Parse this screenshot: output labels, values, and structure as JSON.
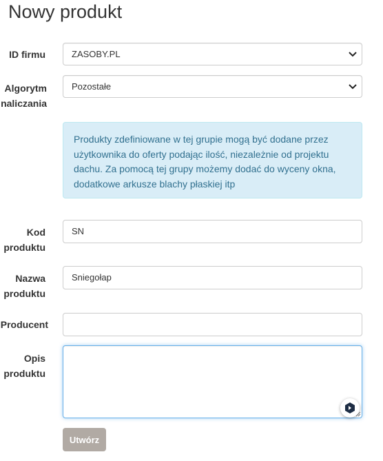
{
  "page": {
    "title": "Nowy produkt"
  },
  "form": {
    "id_firmu": {
      "label": "ID firmu",
      "value": "ZASOBY.PL"
    },
    "algorytm": {
      "label_line1": "Algorytm",
      "label_line2": "naliczania",
      "value": "Pozostałe"
    },
    "info_text": "Produkty zdefiniowane w tej grupie mogą być dodane przez użytkownika do oferty podając ilość, niezależnie od projektu dachu. Za pomocą tej grupy możemy dodać do wyceny okna, dodatkowe arkusze blachy płaskiej itp",
    "kod": {
      "label_line1": "Kod",
      "label_line2": "produktu",
      "value": "SN"
    },
    "nazwa": {
      "label_line1": "Nazwa",
      "label_line2": "produktu",
      "value": "Sniegołap"
    },
    "producent": {
      "label": "Producent",
      "value": ""
    },
    "opis": {
      "label_line1": "Opis",
      "label_line2": "produktu",
      "value": ""
    },
    "submit_label": "Utwórz"
  },
  "icons": {
    "select_arrow": "chevron-down-icon",
    "assistant_badge": "assistant-icon",
    "resize_grip": "resize-grip-icon"
  },
  "colors": {
    "info_bg": "#d9edf7",
    "info_text": "#31708f",
    "button_bg": "#b1aaa4",
    "focus_border": "#66afe9"
  }
}
